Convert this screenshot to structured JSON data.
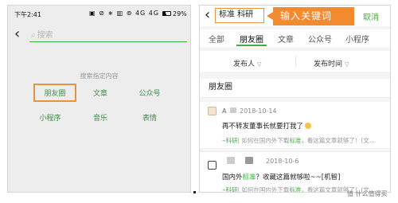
{
  "left_screen": {
    "status_bar": {
      "time": "下午2:41",
      "icons": "▣ ⊘ ∗ ▥ ⊚ 4G 4G ▲",
      "battery_pct": "29%",
      "battery_level": 0.29
    },
    "search": {
      "placeholder": "搜索"
    },
    "hint": "搜索指定内容",
    "grid": [
      {
        "label": "朋友圈",
        "highlighted": true
      },
      {
        "label": "文章"
      },
      {
        "label": "公众号"
      },
      {
        "label": "小程序"
      },
      {
        "label": "音乐"
      },
      {
        "label": "表情"
      }
    ]
  },
  "right_screen": {
    "keyword": "标准 科研",
    "annotation": "输入关键词",
    "cancel_label": "取消",
    "tabs": [
      "全部",
      "朋友圈",
      "文章",
      "公众号",
      "小程序"
    ],
    "active_tab": "朋友圈",
    "filters": {
      "publisher": "发布人",
      "publish_time": "发布时间"
    },
    "section_title": "朋友圈",
    "posts": [
      {
        "name": "A",
        "date": "2018-10-14",
        "text": "再不转发董事长就要打我了",
        "link_source": "科研",
        "link_text_before": "| 如何在国内外下载",
        "link_keyword": "标准",
        "link_text_after": "，看这篇文章就够了！(文..."
      },
      {
        "name": "",
        "date": "2018-10-6",
        "text_before": "国内外",
        "text_keyword": "标准",
        "text_after": "？收藏这篇就够啦~~[机智]",
        "link_source": "科研",
        "link_text_before": "| 如何在国内外下载",
        "link_keyword": "标准",
        "link_text_after": "，看这篇文章就够了！(文..."
      }
    ]
  },
  "watermark": "值 什么值得买",
  "colors": {
    "wechat_green": "#3fb040",
    "annotation_orange": "#f28a30",
    "highlight_border": "#e69243"
  }
}
